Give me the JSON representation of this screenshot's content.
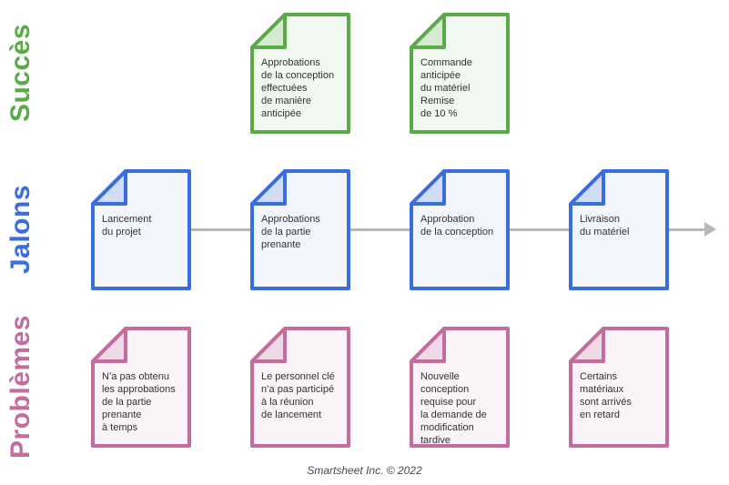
{
  "rows": [
    {
      "key": "success",
      "label": "Succès",
      "colors": {
        "stroke": "#5aab47",
        "fill": "#f1f8ef",
        "fold": "#d5ead0",
        "label": "#5aab47"
      },
      "items": [
        {
          "column": 1,
          "text": "Approbations\nde la conception\neffectuées\nde manière\nanticipée"
        },
        {
          "column": 2,
          "text": "Commande\nanticipée\ndu matériel\nRemise\nde 10 %"
        }
      ]
    },
    {
      "key": "milestones",
      "label": "Jalons",
      "colors": {
        "stroke": "#3a6ee0",
        "fill": "#f3f6fd",
        "fold": "#d1ddf6",
        "label": "#3a6ee0"
      },
      "items": [
        {
          "column": 0,
          "text": "Lancement\ndu projet"
        },
        {
          "column": 1,
          "text": "Approbations\nde la partie\nprenante"
        },
        {
          "column": 2,
          "text": "Approbation\nde la conception"
        },
        {
          "column": 3,
          "text": "Livraison\ndu matériel"
        }
      ]
    },
    {
      "key": "problems",
      "label": "Problèmes",
      "colors": {
        "stroke": "#c56c9f",
        "fill": "#faf3f7",
        "fold": "#f0d9e6",
        "label": "#c56c9f"
      },
      "items": [
        {
          "column": 0,
          "text": "N’a pas obtenu\nles approbations\nde la partie\nprenante\nà temps"
        },
        {
          "column": 1,
          "text": "Le personnel clé\nn’a pas participé\nà la réunion\nde lancement"
        },
        {
          "column": 2,
          "text": "Nouvelle\nconception\nrequise pour\nla demande de\nmodification\ntardive"
        },
        {
          "column": 3,
          "text": "Certains\nmatériaux\nsont arrivés\nen retard"
        }
      ]
    }
  ],
  "timeline": {
    "color": "#b8b8b8",
    "icon": "arrow-right-icon"
  },
  "footer": "Smartsheet Inc. © 2022"
}
